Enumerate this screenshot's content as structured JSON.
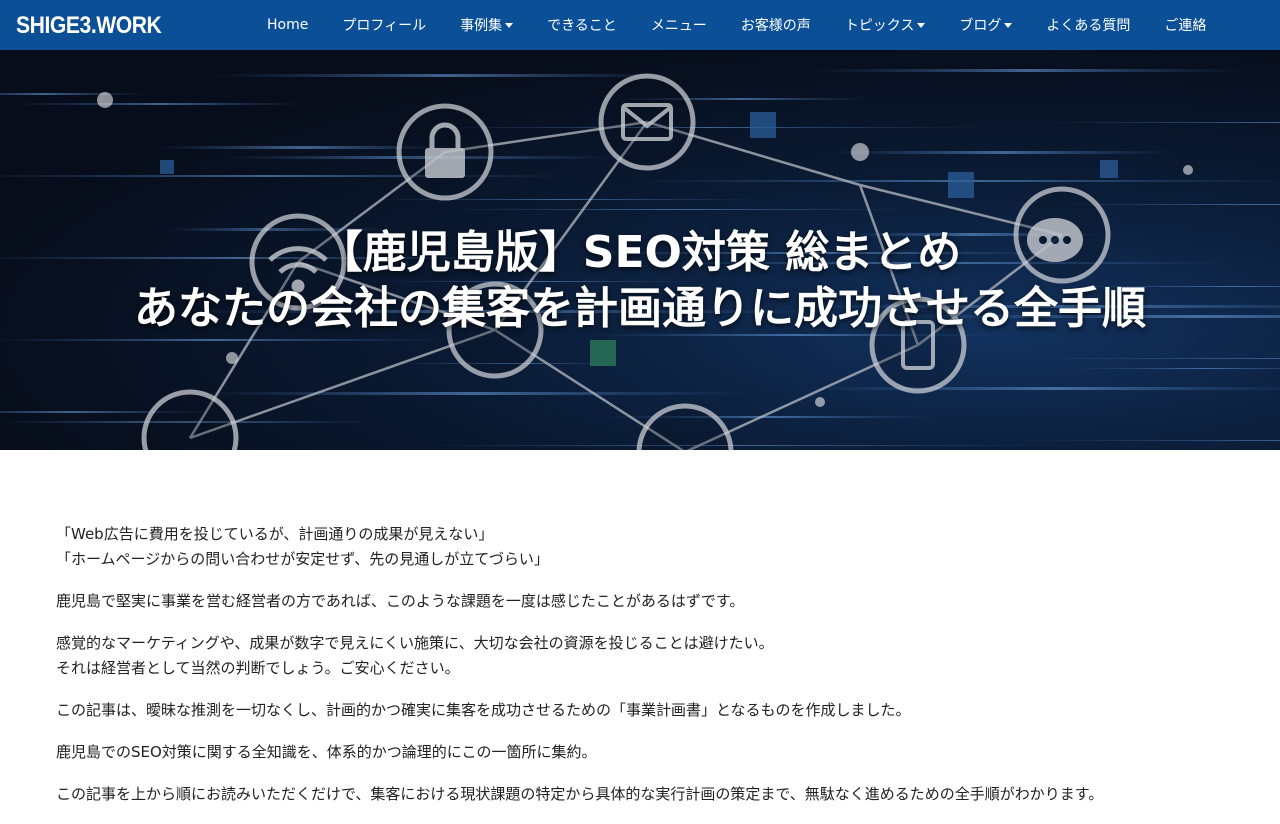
{
  "header": {
    "logo": "SHIGE3.WORK",
    "nav": [
      {
        "label": "Home",
        "dropdown": false
      },
      {
        "label": "プロフィール",
        "dropdown": false
      },
      {
        "label": "事例集",
        "dropdown": true
      },
      {
        "label": "できること",
        "dropdown": false
      },
      {
        "label": "メニュー",
        "dropdown": false
      },
      {
        "label": "お客様の声",
        "dropdown": false
      },
      {
        "label": "トピックス",
        "dropdown": true
      },
      {
        "label": "ブログ",
        "dropdown": true
      },
      {
        "label": "よくある質問",
        "dropdown": false
      },
      {
        "label": "ご連絡",
        "dropdown": false
      }
    ],
    "bg_color": "#0b4f97"
  },
  "hero": {
    "title_line1": "【鹿児島版】SEO対策 総まとめ",
    "title_line2": "あなたの会社の集客を計画通りに成功させる全手順"
  },
  "content": {
    "paragraphs": [
      [
        "「Web広告に費用を投じているが、計画通りの成果が見えない」",
        "「ホームページからの問い合わせが安定せず、先の見通しが立てづらい」"
      ],
      [
        "鹿児島で堅実に事業を営む経営者の方であれば、このような課題を一度は感じたことがあるはずです。"
      ],
      [
        "感覚的なマーケティングや、成果が数字で見えにくい施策に、大切な会社の資源を投じることは避けたい。",
        "それは経営者として当然の判断でしょう。ご安心ください。"
      ],
      [
        "この記事は、曖昧な推測を一切なくし、計画的かつ確実に集客を成功させるための「事業計画書」となるものを作成しました。"
      ],
      [
        "鹿児島でのSEO対策に関する全知識を、体系的かつ論理的にこの一箇所に集約。"
      ],
      [
        "この記事を上から順にお読みいただくだけで、集客における現状課題の特定から具体的な実行計画の策定まで、無駄なく進めるための全手順がわかります。"
      ]
    ]
  }
}
